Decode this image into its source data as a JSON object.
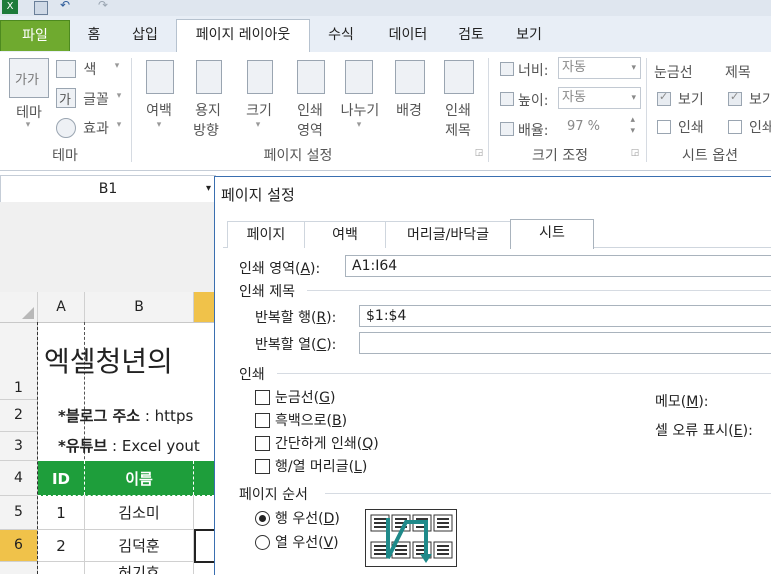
{
  "ribbon_tabs": [
    {
      "label": "파일"
    },
    {
      "label": "홈"
    },
    {
      "label": "삽입"
    },
    {
      "label": "페이지 레이아웃"
    },
    {
      "label": "수식"
    },
    {
      "label": "데이터"
    },
    {
      "label": "검토"
    },
    {
      "label": "보기"
    }
  ],
  "theme_group": {
    "theme_label": "테마",
    "colors": "색",
    "fonts": "글꼴",
    "effects": "효과",
    "group_label": "테마"
  },
  "page_setup_group": {
    "margins": "여백",
    "orientation_1": "용지",
    "orientation_2": "방향",
    "size": "크기",
    "print_area_1": "인쇄",
    "print_area_2": "영역",
    "breaks": "나누기",
    "background": "배경",
    "print_titles_1": "인쇄",
    "print_titles_2": "제목",
    "group_label": "페이지 설정"
  },
  "scale_group": {
    "width_label": "너비:",
    "width_value": "자동",
    "height_label": "높이:",
    "height_value": "자동",
    "scale_label": "배율:",
    "scale_value": "97 %",
    "group_label": "크기 조정"
  },
  "sheet_options_group": {
    "gridlines": "눈금선",
    "headings": "제목",
    "view": "보기",
    "view2": "보기",
    "print": "인쇄",
    "print2": "인쇄",
    "group_label": "시트 옵션"
  },
  "name_box": "B1",
  "sheet": {
    "columns": [
      "A",
      "B"
    ],
    "rows": [
      "1",
      "2",
      "3",
      "4",
      "5",
      "6"
    ],
    "title": "엑셀청년의",
    "blog_label": "*블로그 주소",
    "blog_value": " : https",
    "youtube_label": "*유튜브",
    "youtube_value": " : Excel yout",
    "header_id": "ID",
    "header_name": "이름",
    "row5_id": "1",
    "row5_name": "김소미",
    "row6_id": "2",
    "row6_name": "김덕훈",
    "row7_name": "허기호"
  },
  "dialog": {
    "title": "페이지 설정",
    "tabs": [
      "페이지",
      "여백",
      "머리글/바닥글",
      "시트"
    ],
    "print_area_label_pre": "인쇄 영역(",
    "print_area_key": "A",
    "print_area_label_post": "):",
    "print_area_value": "A1:I64",
    "print_titles_section": "인쇄 제목",
    "rows_repeat_pre": "반복할 행(",
    "rows_repeat_key": "R",
    "rows_repeat_post": "):",
    "rows_repeat_value": "$1:$4",
    "cols_repeat_pre": "반복할 열(",
    "cols_repeat_key": "C",
    "cols_repeat_post": "):",
    "cols_repeat_value": "",
    "print_section": "인쇄",
    "gridlines_pre": "눈금선(",
    "gridlines_key": "G",
    "gridlines_post": ")",
    "bw_pre": "흑백으로(",
    "bw_key": "B",
    "bw_post": ")",
    "draft_pre": "간단하게 인쇄(",
    "draft_key": "Q",
    "draft_post": ")",
    "rowcol_pre": "행/열 머리글(",
    "rowcol_key": "L",
    "rowcol_post": ")",
    "comments_pre": "메모(",
    "comments_key": "M",
    "comments_post": "):",
    "errors_pre": "셀 오류 표시(",
    "errors_key": "E",
    "errors_post": "):",
    "order_section": "페이지 순서",
    "down_pre": "행 우선(",
    "down_key": "D",
    "down_post": ")",
    "over_pre": "열 우선(",
    "over_key": "V",
    "over_post": ")",
    "selected_order": "행 우선"
  },
  "colors": {
    "file_tab": "#6faa2f",
    "header_fill": "#1e9e3b",
    "selected_col": "#f0c24a",
    "dialog_border": "#3a6fb0"
  }
}
